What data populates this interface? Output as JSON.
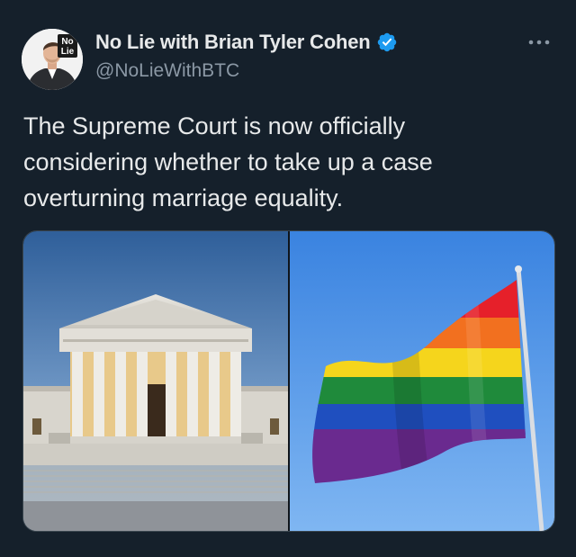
{
  "tweet": {
    "display_name": "No Lie with Brian Tyler Cohen",
    "handle": "@NoLieWithBTC",
    "text": "The Supreme Court is now officially considering whether to take up a case overturning marriage equality.",
    "verified": true,
    "avatar_badge_lines": [
      "No",
      "Lie"
    ]
  },
  "icons": {
    "verified": "verified-badge-icon",
    "more": "more-options-icon"
  },
  "media": {
    "images": [
      {
        "subject": "supreme-court-building"
      },
      {
        "subject": "rainbow-pride-flag"
      }
    ]
  },
  "colors": {
    "background": "#15202b",
    "text_primary": "#e7e9ea",
    "text_secondary": "#8b98a5",
    "verified_blue": "#1d9bf0",
    "border": "#38444d"
  }
}
